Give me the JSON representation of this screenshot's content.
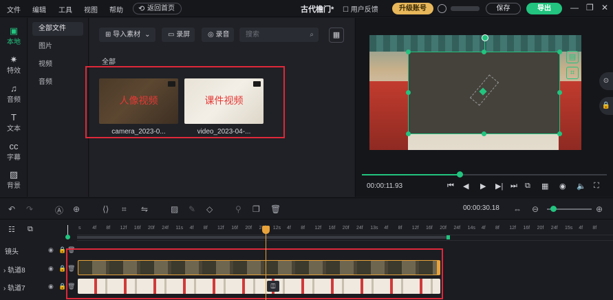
{
  "menu": [
    "文件",
    "编辑",
    "工具",
    "视图",
    "帮助"
  ],
  "header": {
    "home_button": "返回首页",
    "project_title": "古代檐门*",
    "feedback": "用户反馈",
    "upgrade": "升级账号",
    "save": "保存",
    "export": "导出",
    "window_controls": [
      "—",
      "❐",
      "✕"
    ]
  },
  "nav": [
    {
      "label": "本地",
      "icon": "folder-icon",
      "glyph": "▣"
    },
    {
      "label": "特效",
      "icon": "effects-icon",
      "glyph": "✷"
    },
    {
      "label": "音频",
      "icon": "music-icon",
      "glyph": "♫"
    },
    {
      "label": "文本",
      "icon": "text-icon",
      "glyph": "T"
    },
    {
      "label": "字幕",
      "icon": "subtitle-icon",
      "glyph": "cc"
    },
    {
      "label": "背景",
      "icon": "background-icon",
      "glyph": "▨"
    }
  ],
  "categories": [
    "全部文件",
    "图片",
    "视频",
    "音频"
  ],
  "media_toolbar": {
    "import": "导入素材",
    "record_screen": "录屏",
    "record_audio": "录音",
    "search_placeholder": "搜索"
  },
  "media_section_label": "全部",
  "media_items": [
    {
      "name": "camera_2023-0...",
      "overlay": "人像视频"
    },
    {
      "name": "video_2023-04-...",
      "overlay": "课件视频"
    }
  ],
  "player": {
    "current_time": "00:00:11.93",
    "progress_fraction": 0.4,
    "controls": [
      "⏮",
      "◀",
      "▶",
      "▶|",
      "⏭",
      "⧉",
      "▦",
      "◉",
      "🔈",
      "⛶"
    ]
  },
  "timeline": {
    "total_time": "00:00:30.18",
    "ruler_labels": [
      "s",
      "4f",
      "8f",
      "12f",
      "16f",
      "20f",
      "24f",
      "11s",
      "4f",
      "8f",
      "12f",
      "16f",
      "20f",
      "24f",
      "12s",
      "4f",
      "8f",
      "12f",
      "16f",
      "20f",
      "24f",
      "13s",
      "4f",
      "8f",
      "12f",
      "16f",
      "20f",
      "24f",
      "14s",
      "4f",
      "8f",
      "12f",
      "16f",
      "20f",
      "24f",
      "15s",
      "4f",
      "8f"
    ],
    "tracks": [
      {
        "label": "镜头"
      },
      {
        "label": "轨道8"
      },
      {
        "label": "轨道7"
      }
    ]
  },
  "colors": {
    "accent": "#22c47f",
    "upgrade": "#e8b85b",
    "playhead": "#e8a33b",
    "highlight": "#e0283a"
  }
}
